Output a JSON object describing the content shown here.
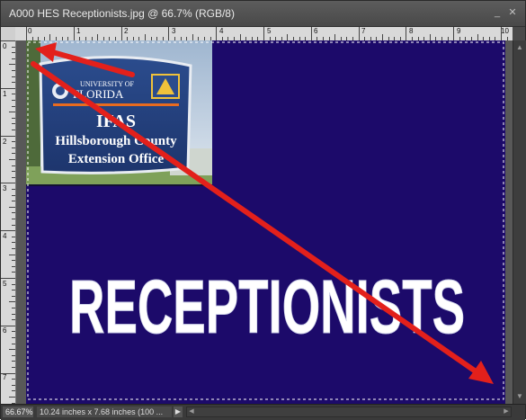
{
  "window": {
    "title": "A000 HES Receptionists.jpg @ 66.7% (RGB/8)",
    "minimize_glyph": "_",
    "close_glyph": "✕"
  },
  "ruler": {
    "top_labels": [
      "0",
      "1",
      "2",
      "3",
      "4",
      "5",
      "6",
      "7",
      "8",
      "9",
      "10"
    ],
    "left_labels": [
      "0",
      "1",
      "2",
      "3",
      "4",
      "5",
      "6",
      "7"
    ]
  },
  "sign": {
    "university_line1": "UNIVERSITY OF",
    "university_line2": "FLORIDA",
    "ifas": "IFAS",
    "line2": "Hillsborough County",
    "line3": "Extension Office"
  },
  "document": {
    "headline": "RECEPTIONISTS",
    "background_color": "#1c0a6a",
    "arrow_color": "#e3201b"
  },
  "status": {
    "zoom": "66.67%",
    "doc_info": "10.24 inches x 7.68 inches (100 ..."
  },
  "icons": [
    "chevron-right-icon",
    "scroll-up-icon",
    "scroll-down-icon",
    "scroll-left-icon",
    "scroll-right-icon",
    "minimize-icon",
    "close-icon"
  ]
}
